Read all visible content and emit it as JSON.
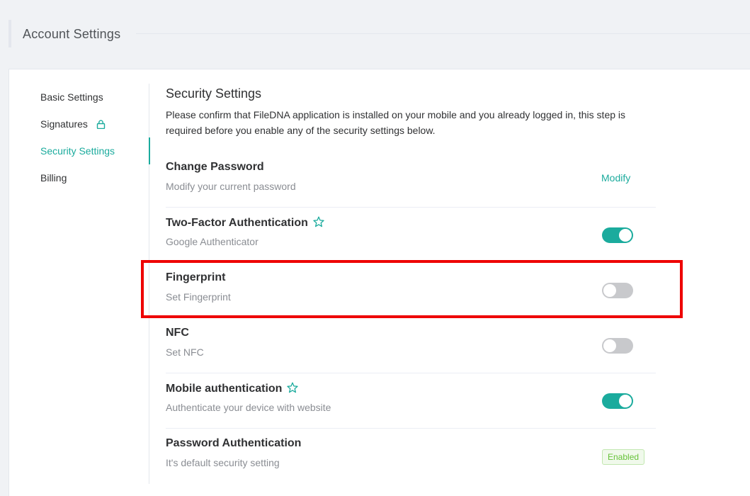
{
  "page": {
    "title": "Account Settings"
  },
  "sidebar": {
    "items": [
      {
        "label": "Basic Settings",
        "icon": null,
        "active": false
      },
      {
        "label": "Signatures",
        "icon": "lock-icon",
        "active": false
      },
      {
        "label": "Security Settings",
        "icon": null,
        "active": true
      },
      {
        "label": "Billing",
        "icon": null,
        "active": false
      }
    ]
  },
  "security": {
    "title": "Security Settings",
    "description": "Please confirm that FileDNA application is installed on your mobile and you already logged in, this step is required before you enable any of the security settings below.",
    "rows": [
      {
        "title": "Change Password",
        "subtitle": "Modify your current password",
        "control": "link",
        "link_label": "Modify",
        "starred": false
      },
      {
        "title": "Two-Factor Authentication",
        "subtitle": "Google Authenticator",
        "control": "toggle",
        "enabled": true,
        "starred": true
      },
      {
        "title": "Fingerprint",
        "subtitle": "Set Fingerprint",
        "control": "toggle",
        "enabled": false,
        "starred": false,
        "highlighted": true
      },
      {
        "title": "NFC",
        "subtitle": "Set NFC",
        "control": "toggle",
        "enabled": false,
        "starred": false
      },
      {
        "title": "Mobile authentication",
        "subtitle": "Authenticate your device with website",
        "control": "toggle",
        "enabled": true,
        "starred": true
      },
      {
        "title": "Password Authentication",
        "subtitle": "It's default security setting",
        "control": "badge",
        "badge_label": "Enabled",
        "starred": false
      }
    ]
  },
  "colors": {
    "accent": "#1bab9d",
    "toggle_off": "#c8c9cc",
    "highlight": "#ee0000",
    "badge_text": "#67c23a"
  }
}
